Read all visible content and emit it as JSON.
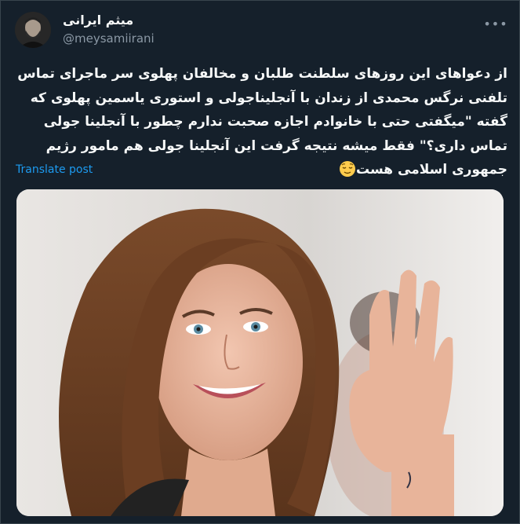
{
  "author": {
    "name": "میثم ایرانی",
    "handle": "@meysamiirani"
  },
  "post": {
    "text": "از دعواهای این روزهای سلطنت طلبان و مخالفان پهلوی سر ماجرای تماس تلفنی نرگس محمدی از زندان با آنجلیناجولی و استوری یاسمین پهلوی که گفته \"میگفتی حتی با خانوادم اجازه صحبت ندارم چطور با آنجلینا جولی تماس داری؟\" فقط میشه نتیجه گرفت این آنجلینا جولی هم مامور رژیم جمهوری اسلامی هست",
    "emoji": "relieved-face-emoji",
    "translate_label": "Translate post"
  },
  "media": {
    "description_icon": "photo"
  },
  "icons": {
    "more": "more-dots-icon"
  },
  "colors": {
    "background": "#15202b",
    "link": "#1d9bf0",
    "secondary_text": "#8b98a5",
    "border": "#38444d"
  }
}
